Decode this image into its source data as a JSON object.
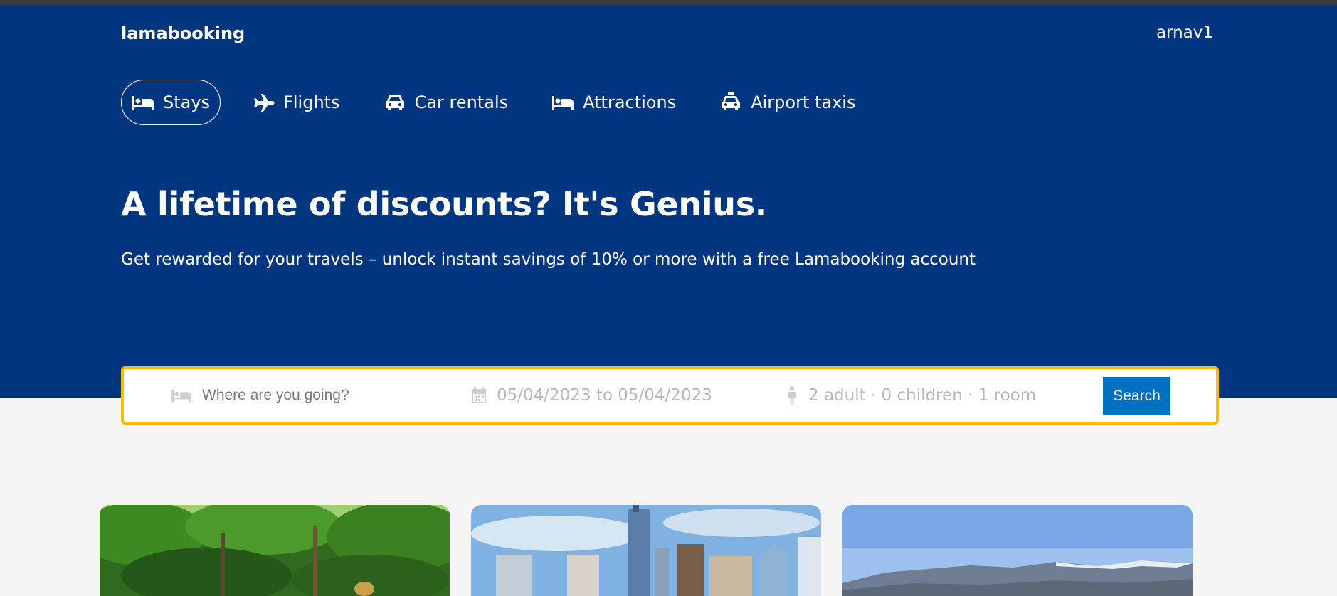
{
  "app": {
    "logo": "lamabooking",
    "user": "arnav1"
  },
  "nav": {
    "items": [
      {
        "label": "Stays",
        "icon": "bed-icon",
        "active": true
      },
      {
        "label": "Flights",
        "icon": "plane-icon"
      },
      {
        "label": "Car rentals",
        "icon": "car-icon"
      },
      {
        "label": "Attractions",
        "icon": "bed-icon"
      },
      {
        "label": "Airport taxis",
        "icon": "taxi-icon"
      }
    ]
  },
  "hero": {
    "title": "A lifetime of discounts? It's Genius.",
    "subtitle": "Get rewarded for your travels – unlock instant savings of 10% or more with a free Lamabooking account"
  },
  "search": {
    "destination_placeholder": "Where are you going?",
    "date_range": "05/04/2023 to 05/04/2023",
    "options": "2 adult · 0 children · 1 room",
    "button": "Search"
  },
  "colors": {
    "header_bg": "#003580",
    "search_border": "#febb02",
    "button_bg": "#0071c2",
    "page_bg": "#f5f5f5"
  },
  "featured": [
    {
      "image": "forest-photo"
    },
    {
      "image": "city-skyline-photo"
    },
    {
      "image": "mountains-photo"
    }
  ]
}
